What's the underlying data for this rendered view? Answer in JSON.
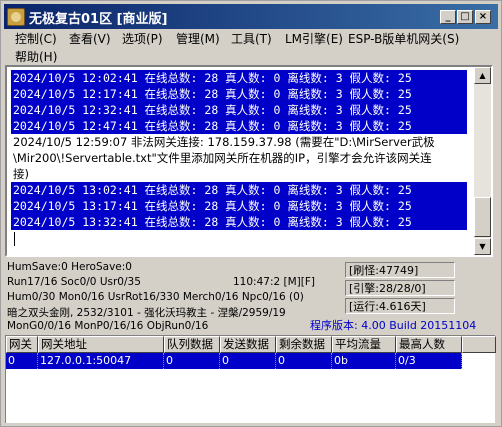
{
  "window": {
    "title": "无极复古01区 [商业版]",
    "controls": {
      "minimize": "_",
      "maximize": "□",
      "close": "×"
    }
  },
  "menu": [
    "控制(C)",
    "查看(V)",
    "选项(P)",
    "管理(M)",
    "工具(T)",
    "LM引擎(E)",
    "ESP-B版单机网关(S)",
    "帮助(H)"
  ],
  "log": [
    {
      "text": "2024/10/5 12:02:41 在线总数: 28 真人数: 0 离线数: 3 假人数: 25",
      "selected": true
    },
    {
      "text": "2024/10/5 12:17:41 在线总数: 28 真人数: 0 离线数: 3 假人数: 25",
      "selected": true
    },
    {
      "text": "2024/10/5 12:32:41 在线总数: 28 真人数: 0 离线数: 3 假人数: 25",
      "selected": true
    },
    {
      "text": "2024/10/5 12:47:41 在线总数: 28 真人数: 0 离线数: 3 假人数: 25",
      "selected": true
    },
    {
      "text": "2024/10/5 12:59:07 非法网关连接: 178.159.37.98 (需要在\"D:\\MirServer武极",
      "selected": false
    },
    {
      "text": "\\Mir200\\!Servertable.txt\"文件里添加网关所在机器的IP，引擎才会允许该网关连",
      "selected": false
    },
    {
      "text": "接)",
      "selected": false
    },
    {
      "text": "2024/10/5 13:02:41 在线总数: 28 真人数: 0 离线数: 3 假人数: 25",
      "selected": true
    },
    {
      "text": "2024/10/5 13:17:41 在线总数: 28 真人数: 0 离线数: 3 假人数: 25",
      "selected": true
    },
    {
      "text": "2024/10/5 13:32:41 在线总数: 28 真人数: 0 离线数: 3 假人数: 25",
      "selected": true
    }
  ],
  "status": {
    "line1": "HumSave:0 HeroSave:0",
    "line2": "Run17/16 Soc0/0 Usr0/35",
    "time": "110:47:2 [M][F]",
    "line3": "Hum0/30 Mon0/16 UsrRot16/330 Merch0/16 Npc0/16 (0)",
    "line4": "暗之双头金刚, 2532/3101 - 强化沃玛教主 - 涅槃/2959/19",
    "line5": "MonG0/0/16 MonP0/16/16 ObjRun0/16",
    "refresh": "[刷怪:47749]",
    "engine": "[引擎:28/28/0]",
    "runtime": "[运行:4.616天]",
    "version": "程序版本: 4.00 Build 20151104"
  },
  "table": {
    "headers": [
      "网关",
      "网关地址",
      "队列数据",
      "发送数据",
      "剩余数据",
      "平均流量",
      "最高人数"
    ],
    "rows": [
      [
        "0",
        "127.0.0.1:50047",
        "0",
        "0",
        "0",
        "0b",
        "0/3"
      ]
    ]
  },
  "colors": {
    "selection": "#0000c8",
    "titlebar": "#0a246a",
    "version": "#0000c8"
  }
}
